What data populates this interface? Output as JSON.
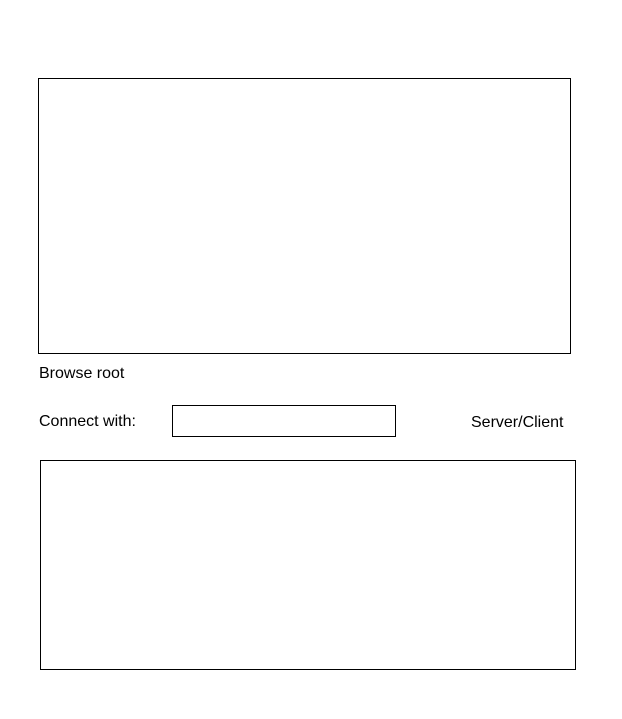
{
  "browse": {
    "label": "Browse root"
  },
  "connect": {
    "label": "Connect with:",
    "value": "",
    "placeholder": ""
  },
  "mode": {
    "label": "Server/Client"
  }
}
